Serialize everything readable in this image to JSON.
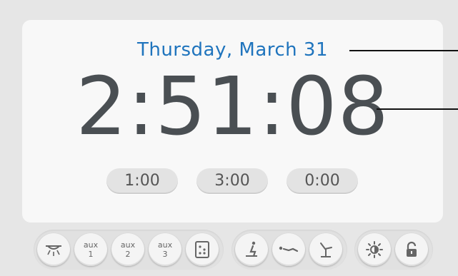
{
  "display": {
    "date": "Thursday, March 31",
    "time": "2:51:08"
  },
  "presets": [
    "1:00",
    "3:00",
    "0:00"
  ],
  "toolbar": {
    "aux1": {
      "top": "aux",
      "bottom": "1"
    },
    "aux2": {
      "top": "aux",
      "bottom": "2"
    },
    "aux3": {
      "top": "aux",
      "bottom": "3"
    }
  },
  "icons": {
    "light": "overhead-light-icon",
    "dice": "dice-icon",
    "chair_up": "chair-position-icon",
    "chair_flat": "chair-flat-icon",
    "chair_recline": "chair-recline-icon",
    "brightness": "brightness-icon",
    "lock": "lock-icon"
  },
  "colors": {
    "date": "#1f74bd",
    "time": "#4a4f53",
    "panel": "#f8f8f8",
    "background": "#e6e6e6"
  }
}
